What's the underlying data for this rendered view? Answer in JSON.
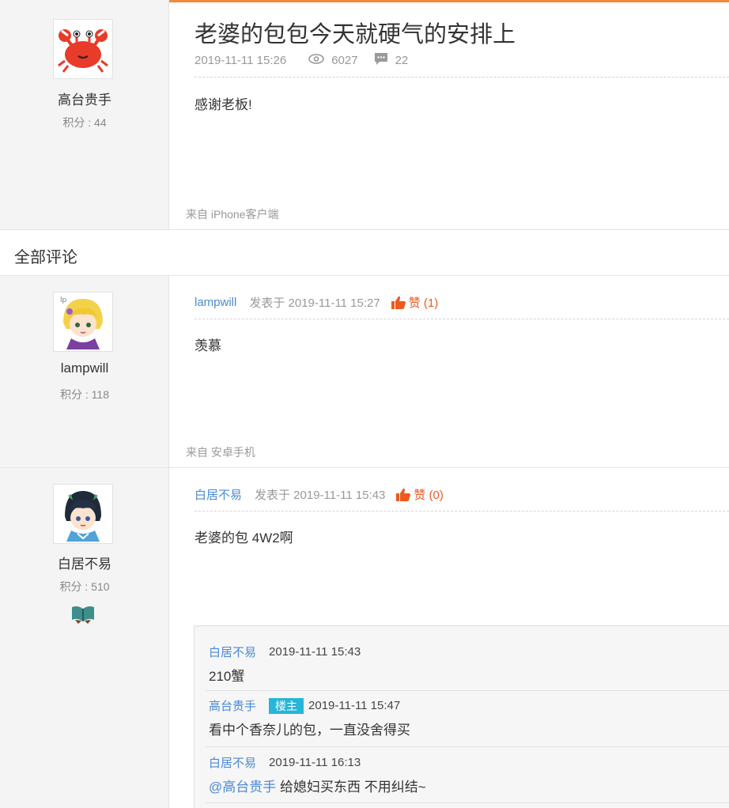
{
  "post": {
    "title": "老婆的包包今天就硬气的安排上",
    "date": "2019-11-11 15:26",
    "views": "6027",
    "comments": "22",
    "body": "感谢老板!",
    "source": "来自 iPhone客户端",
    "author": {
      "name": "高台贵手",
      "score": "积分 : 44",
      "avatar_icon": "crab-avatar"
    }
  },
  "section": {
    "all_comments": "全部评论"
  },
  "comments": [
    {
      "author": {
        "name": "lampwill",
        "score": "积分 : 118",
        "avatar_icon": "blonde-anime-avatar"
      },
      "user": "lampwill",
      "posted": "发表于 2019-11-11 15:27",
      "like": "赞 (1)",
      "text": "羡慕",
      "source": "来自 安卓手机"
    },
    {
      "author": {
        "name": "白居不易",
        "score": "积分 : 510",
        "avatar_icon": "dark-hair-anime-avatar",
        "badge_icon": "book-badge-icon"
      },
      "user": "白居不易",
      "posted": "发表于 2019-11-11 15:43",
      "like": "赞 (0)",
      "text": "老婆的包 4W2啊",
      "replies": [
        {
          "user": "白居不易",
          "time": "2019-11-11 15:43",
          "text": "210蟹"
        },
        {
          "user": "高台贵手",
          "tag": "楼主",
          "time": "2019-11-11 15:47",
          "text": "看中个香奈儿的包，一直没舍得买"
        },
        {
          "user": "白居不易",
          "time": "2019-11-11 16:13",
          "mention": "@高台贵手",
          "text": " 给媳妇买东西 不用纠结~"
        }
      ]
    }
  ],
  "colors": {
    "accent": "#f08a3c",
    "link": "#4a8ad6",
    "like": "#ef5a1e",
    "owner_tag": "#26b6d8"
  }
}
